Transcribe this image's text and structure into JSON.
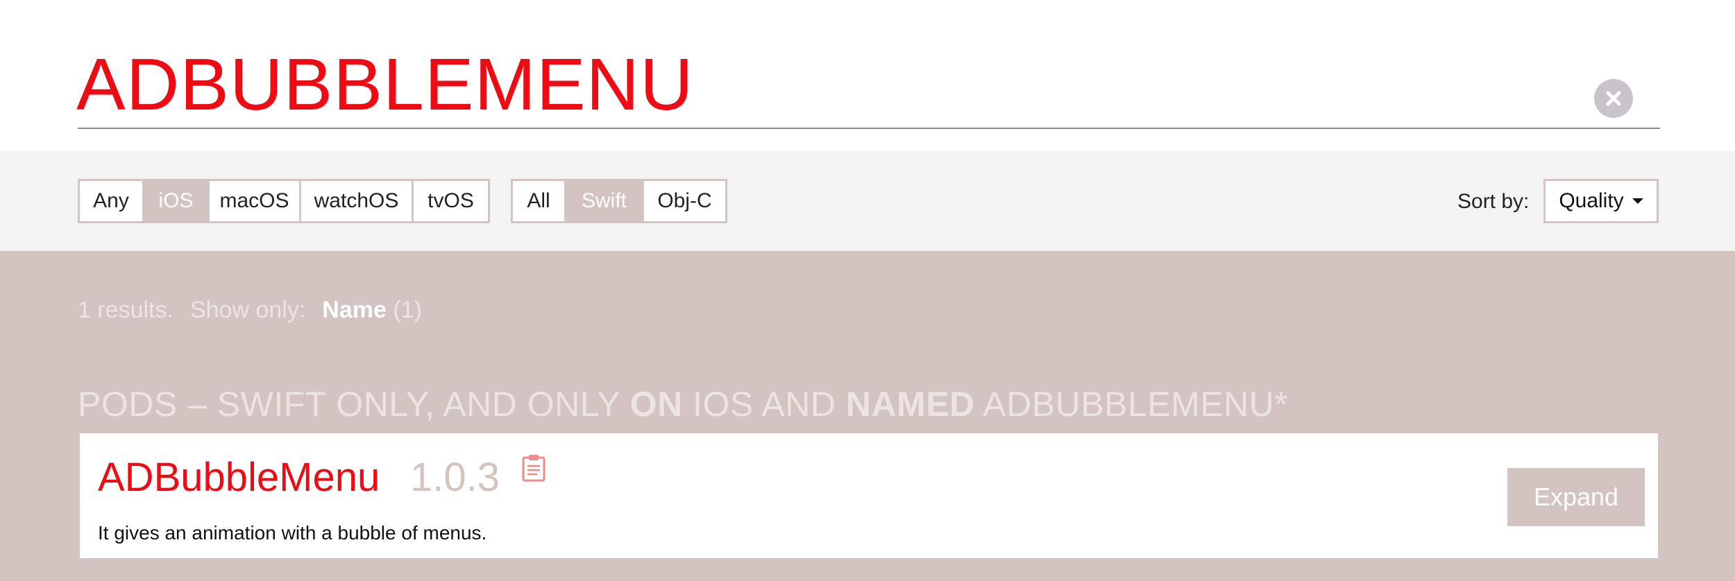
{
  "search": {
    "query": "ADBUBBLEMENU"
  },
  "filters": {
    "platforms": [
      {
        "label": "Any",
        "active": false
      },
      {
        "label": "iOS",
        "active": true
      },
      {
        "label": "macOS",
        "active": false
      },
      {
        "label": "watchOS",
        "active": false
      },
      {
        "label": "tvOS",
        "active": false
      }
    ],
    "languages": [
      {
        "label": "All",
        "active": false
      },
      {
        "label": "Swift",
        "active": true
      },
      {
        "label": "Obj-C",
        "active": false
      }
    ],
    "sort_label": "Sort by:",
    "sort_value": "Quality"
  },
  "results": {
    "count_text": "1 results.",
    "show_only_label": "Show only:",
    "show_only_option": "Name",
    "show_only_count": "(1)",
    "heading": {
      "part1": "PODS – SWIFT ONLY, AND ONLY ",
      "bold1": "ON",
      "part2": " IOS AND ",
      "bold2": "NAMED",
      "part3": " ADBUBBLEMENU*"
    },
    "items": [
      {
        "name": "ADBubbleMenu",
        "version": "1.0.3",
        "description": "It gives an animation with a bubble of menus.",
        "expand_label": "Expand"
      }
    ]
  },
  "colors": {
    "accent": "#ee0b14",
    "muted": "#d3c4c1",
    "filter_bg": "#f4f4f4"
  },
  "icons": [
    "close-circle-icon",
    "clipboard-icon",
    "caret-down-icon"
  ]
}
